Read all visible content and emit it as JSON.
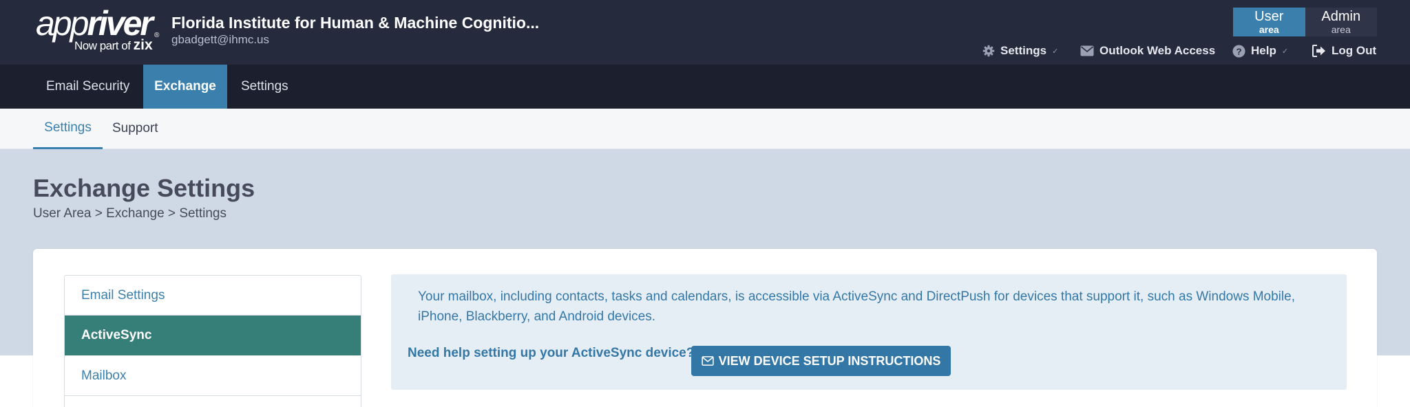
{
  "header": {
    "logo": {
      "word": "appriver",
      "word_light": "app",
      "word_bold": "river",
      "tagline": "Now part of",
      "tagline_brand": "zix",
      "mark": "®"
    },
    "org_name": "Florida Institute for Human & Machine Cognitio...",
    "user_email": "gbadgett@ihmc.us",
    "area_switch": [
      {
        "title": "User",
        "sub": "area",
        "active": true
      },
      {
        "title": "Admin",
        "sub": "area",
        "active": false
      }
    ],
    "utility": {
      "settings": {
        "label": "Settings",
        "icon": "gear-icon"
      },
      "owa": {
        "label": "Outlook Web Access",
        "icon": "envelope-icon"
      },
      "help": {
        "label": "Help",
        "icon": "question-circle-icon"
      },
      "logout": {
        "label": "Log Out",
        "icon": "sign-out-icon"
      }
    }
  },
  "main_nav": [
    {
      "label": "Email Security",
      "active": false
    },
    {
      "label": "Exchange",
      "active": true
    },
    {
      "label": "Settings",
      "active": false
    }
  ],
  "sub_nav": [
    {
      "label": "Settings",
      "active": true
    },
    {
      "label": "Support",
      "active": false
    }
  ],
  "page": {
    "title": "Exchange Settings",
    "breadcrumb": [
      "User Area",
      "Exchange",
      "Settings"
    ],
    "breadcrumb_sep": " > "
  },
  "side_menu": [
    {
      "label": "Email Settings",
      "active": false
    },
    {
      "label": "ActiveSync",
      "active": true
    },
    {
      "label": "Mailbox",
      "active": false
    }
  ],
  "info": {
    "text": "Your mailbox, including contacts, tasks and calendars, is accessible via ActiveSync and DirectPush for devices that support it, such as Windows Mobile, iPhone, Blackberry, and Android devices.",
    "help_question": "Need help setting up your ActiveSync device?",
    "button_label": "VIEW DEVICE SETUP INSTRUCTIONS",
    "button_icon": "envelope-icon"
  },
  "colors": {
    "header_bg": "#262a3d",
    "nav_bg": "#1c1f2e",
    "accent": "#3b80ac",
    "active_teal": "#357f78",
    "band_bg": "#cfd9e5",
    "info_bg": "#e6eef5"
  }
}
